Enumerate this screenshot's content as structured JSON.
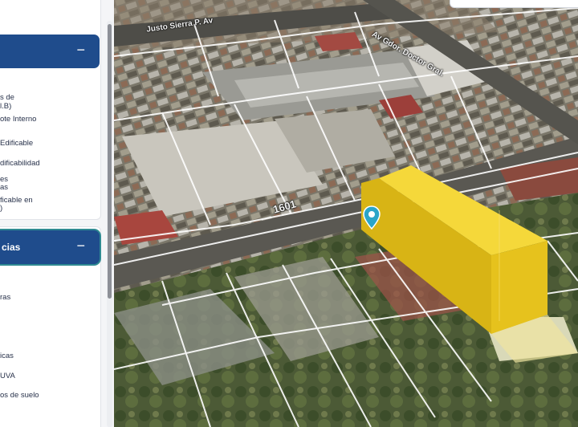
{
  "sidebar": {
    "section1": {
      "title": "",
      "collapse_symbol": "−",
      "items": [
        "s de",
        "l.B)",
        "ote Interno",
        "Edificable",
        "dificabilidad",
        "es",
        "as",
        "ficable en",
        ")"
      ]
    },
    "section2": {
      "title": "cias",
      "collapse_symbol": "−",
      "items": [
        "ras",
        "icas",
        "UVA",
        "os de suelo"
      ]
    }
  },
  "map": {
    "street_labels": [
      "Justo Sierra P. Av",
      "Av Gdor. Doctor Gral.",
      "1601"
    ],
    "highlight_color": "#f2cf1f",
    "pin_color": "#2aa5c8",
    "pin_icon": "map-pin-icon"
  }
}
